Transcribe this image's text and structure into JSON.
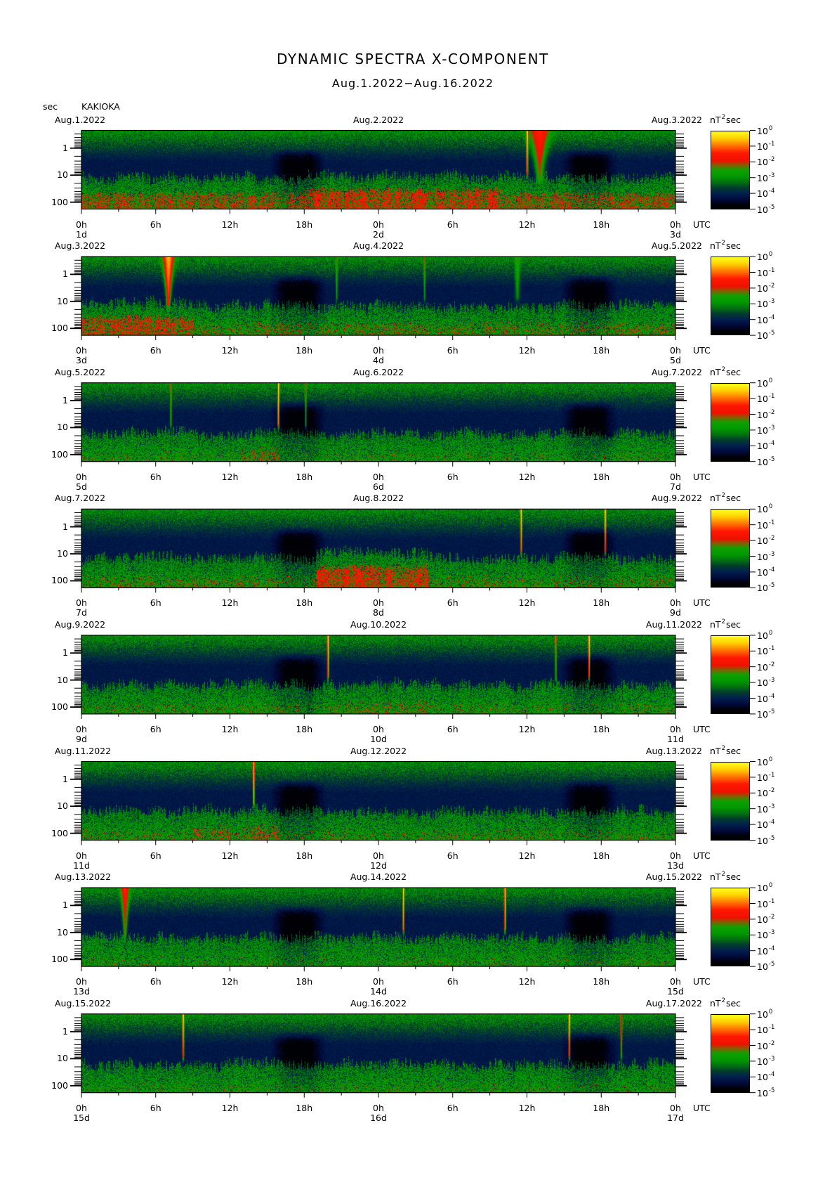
{
  "chart_data": {
    "type": "heatmap",
    "title": "DYNAMIC SPECTRA X-COMPONENT",
    "subtitle": "Aug.1.2022−Aug.16.2022",
    "station": "KAKIOKA",
    "ylabel": "sec",
    "y_scale": "log",
    "ylim": [
      0.22,
      180
    ],
    "y_ticks": [
      1,
      10,
      100
    ],
    "y_tick_labels": [
      "1",
      "10",
      "100"
    ],
    "xlim": [
      0,
      48
    ],
    "x_ticks": [
      0,
      6,
      12,
      18,
      24,
      30,
      36,
      42,
      48
    ],
    "x_tick_labels": [
      "0h",
      "6h",
      "12h",
      "18h",
      "0h",
      "6h",
      "12h",
      "18h",
      "0h"
    ],
    "x_unit": "UTC",
    "colorbar": {
      "unit": "nT",
      "unit_exp": "2",
      "unit_suffix": "sec",
      "scale": "log",
      "ticks": [
        {
          "base": "10",
          "exp": "0"
        },
        {
          "base": "10",
          "exp": "-1"
        },
        {
          "base": "10",
          "exp": "-2"
        },
        {
          "base": "10",
          "exp": "-3"
        },
        {
          "base": "10",
          "exp": "-4"
        },
        {
          "base": "10",
          "exp": "-5"
        }
      ]
    },
    "panels": [
      {
        "dates": [
          "Aug.1.2022",
          "Aug.2.2022",
          "Aug.3.2022"
        ],
        "day_labels": [
          "1d",
          "2d",
          "3d"
        ],
        "events": [
          {
            "hour": 36.0,
            "power": 1.0,
            "width": 0.15
          },
          {
            "hour": 37.0,
            "power": 0.05,
            "width": 1.6
          }
        ]
      },
      {
        "dates": [
          "Aug.3.2022",
          "Aug.4.2022",
          "Aug.5.2022"
        ],
        "day_labels": [
          "3d",
          "4d",
          "5d"
        ],
        "events": [
          {
            "hour": 7.0,
            "power": 0.3,
            "width": 0.9
          },
          {
            "hour": 20.6,
            "power": 0.01,
            "width": 0.15
          },
          {
            "hour": 27.7,
            "power": 0.01,
            "width": 0.15
          },
          {
            "hour": 35.2,
            "power": 0.005,
            "width": 0.4
          }
        ]
      },
      {
        "dates": [
          "Aug.5.2022",
          "Aug.6.2022",
          "Aug.7.2022"
        ],
        "day_labels": [
          "5d",
          "6d",
          "7d"
        ],
        "events": [
          {
            "hour": 7.2,
            "power": 0.03,
            "width": 0.12
          },
          {
            "hour": 15.9,
            "power": 1.0,
            "width": 0.15
          },
          {
            "hour": 18.1,
            "power": 0.02,
            "width": 0.12
          }
        ]
      },
      {
        "dates": [
          "Aug.7.2022",
          "Aug.8.2022",
          "Aug.9.2022"
        ],
        "day_labels": [
          "7d",
          "8d",
          "9d"
        ],
        "events": [
          {
            "hour": 35.5,
            "power": 1.0,
            "width": 0.12
          },
          {
            "hour": 42.3,
            "power": 1.0,
            "width": 0.12
          }
        ]
      },
      {
        "dates": [
          "Aug.9.2022",
          "Aug.10.2022",
          "Aug.11.2022"
        ],
        "day_labels": [
          "9d",
          "10d",
          "11d"
        ],
        "events": [
          {
            "hour": 19.9,
            "power": 1.0,
            "width": 0.12
          },
          {
            "hour": 38.3,
            "power": 0.1,
            "width": 0.12
          },
          {
            "hour": 41.0,
            "power": 1.0,
            "width": 0.12
          }
        ]
      },
      {
        "dates": [
          "Aug.11.2022",
          "Aug.12.2022",
          "Aug.13.2022"
        ],
        "day_labels": [
          "11d",
          "12d",
          "13d"
        ],
        "events": [
          {
            "hour": 13.9,
            "power": 1.0,
            "width": 0.12
          }
        ]
      },
      {
        "dates": [
          "Aug.13.2022",
          "Aug.14.2022",
          "Aug.15.2022"
        ],
        "day_labels": [
          "13d",
          "14d",
          "15d"
        ],
        "events": [
          {
            "hour": 3.5,
            "power": 0.05,
            "width": 0.7
          },
          {
            "hour": 26.0,
            "power": 1.0,
            "width": 0.12
          },
          {
            "hour": 34.2,
            "power": 1.0,
            "width": 0.12
          }
        ]
      },
      {
        "dates": [
          "Aug.15.2022",
          "Aug.16.2022",
          "Aug.17.2022"
        ],
        "day_labels": [
          "15d",
          "16d",
          "17d"
        ],
        "events": [
          {
            "hour": 8.2,
            "power": 1.0,
            "width": 0.12
          },
          {
            "hour": 39.4,
            "power": 1.0,
            "width": 0.12
          },
          {
            "hour": 43.6,
            "power": 0.05,
            "width": 0.12
          }
        ]
      }
    ]
  }
}
